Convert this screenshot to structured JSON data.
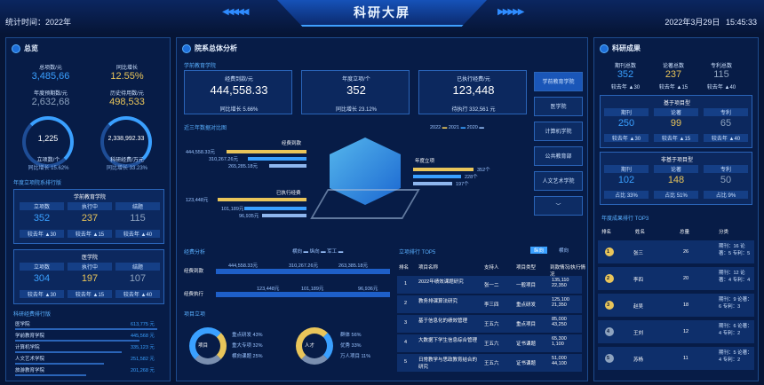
{
  "header": {
    "title": "科研大屏",
    "stat_time": "统计时间：2022年",
    "date": "2022年3月29日",
    "time": "15:45:33"
  },
  "overview": {
    "title": "总览",
    "k1_label": "总项数/元",
    "k1_value": "3,485,66",
    "k2_label": "同比增长",
    "k2_value": "12.55%",
    "k3_label": "年度预期数/元",
    "k3_value": "2,632,68",
    "k4_label": "历史待用数/元",
    "k4_value": "498,533",
    "g1_value": "1,225",
    "g1_label": "立项数/个",
    "g1_sub": "同比增长 15.62%",
    "g2_value": "2,338,992.33",
    "g2_label": "科研经费/万元",
    "g2_sub": "同比增长 33.23%",
    "college_title": "年度立项院系排行版",
    "college1": {
      "name": "学前教育学院",
      "h": [
        "立项数",
        "执行中",
        "结题"
      ],
      "v": [
        "352",
        "237",
        "115"
      ],
      "c": [
        "较去年 ▲30",
        "较去年 ▲15",
        "较去年 ▲40"
      ]
    },
    "college2": {
      "name": "医学院",
      "h": [
        "立项数",
        "执行中",
        "结题"
      ],
      "v": [
        "304",
        "197",
        "107"
      ],
      "c": [
        "较去年 ▲30",
        "较去年 ▲15",
        "较去年 ▲40"
      ]
    },
    "rank_title": "科研经费排行版",
    "rank": [
      {
        "n": "医学院",
        "v": "613,775 元"
      },
      {
        "n": "学前教育学院",
        "v": "445,568 元"
      },
      {
        "n": "计算机学院",
        "v": "335,123 元"
      },
      {
        "n": "人文艺术学院",
        "v": "251,582 元"
      },
      {
        "n": "旅游教育学院",
        "v": "201,268 元"
      }
    ]
  },
  "center": {
    "title": "院系总体分析",
    "sub": "学前教育学院",
    "cards": [
      {
        "label": "经费到款/元",
        "value": "444,558.33",
        "foot": "同比增长 5.66%"
      },
      {
        "label": "年度立项/个",
        "value": "352",
        "foot": "同比增长 23.12%"
      },
      {
        "label": "已执行经费/元",
        "value": "123,448",
        "foot": "待执行 332,561 元"
      }
    ],
    "side": [
      "学前教育学院",
      "医学院",
      "计算机学院",
      "公共教育部",
      "人文艺术学院"
    ],
    "side_more": "﹀",
    "compare_title": "近三年数据对比图",
    "legend": [
      "2022",
      "2021",
      "2020"
    ],
    "tags": {
      "a": "经费到款",
      "b": "已执行经费",
      "c": "年度立项"
    },
    "left_vals": [
      "444,558.33元",
      "310,267.26元",
      "265,285.18元",
      "123,448元",
      "101,189元",
      "96,935元"
    ],
    "right_vals": [
      "352个",
      "228个",
      "197个"
    ],
    "expense_title": "经费分析",
    "exp_legend": [
      "横向",
      "纵向",
      "军工"
    ],
    "exp_r1": [
      "经费到款",
      "444,558.33元",
      "310,267.26元",
      "263,385.18元"
    ],
    "exp_r2": [
      "经费执行",
      "123,448元",
      "101,189元",
      "96,936元"
    ],
    "proj_title": "项目立项",
    "donut1": "项目",
    "donut2": "人才",
    "d1": [
      "重点研发 43%",
      "重大专项 32%",
      "横向课题 25%"
    ],
    "d2": [
      "群体 56%",
      "优秀 33%",
      "万人项目 11%"
    ]
  },
  "top5": {
    "title": "立项排行 TOP5",
    "toggle": [
      "纵向",
      "横向"
    ],
    "h": [
      "排名",
      "项目名称",
      "支持人",
      "项目类型",
      "到款情况/执行情况"
    ],
    "rows": [
      {
        "r": "1",
        "n": "2022年绩效课题研究",
        "p": "张一二",
        "t": "一般项目",
        "v": "135,110 22,350"
      },
      {
        "r": "2",
        "n": "教务排课算法研究",
        "p": "李三四",
        "t": "重点研发",
        "v": "125,100 21,350"
      },
      {
        "r": "3",
        "n": "基于信息化的绩效管理",
        "p": "王五六",
        "t": "重点项目",
        "v": "85,000 43,250"
      },
      {
        "r": "4",
        "n": "大数据下学生信息综合管理",
        "p": "王五六",
        "t": "证书课题",
        "v": "65,300 1,100"
      },
      {
        "r": "5",
        "n": "日常教学与思政教育结合的研究",
        "p": "王五六",
        "t": "证书课题",
        "v": "51,000 44,100"
      }
    ]
  },
  "right": {
    "title": "科研成果",
    "top_h": [
      "期刊总数",
      "论著总数",
      "专利总数"
    ],
    "top_v": [
      "352",
      "237",
      "115"
    ],
    "top_c": [
      "较去年 ▲30",
      "较去年 ▲15",
      "较去年 ▲40"
    ],
    "g1": {
      "title": "基于项目型",
      "h": [
        "期刊",
        "论著",
        "专利"
      ],
      "v": [
        "250",
        "99",
        "65"
      ],
      "c": [
        "较去年 ▲30",
        "较去年 ▲15",
        "较去年 ▲40"
      ]
    },
    "g2": {
      "title": "非基于项目型",
      "h": [
        "期刊",
        "论著",
        "专利"
      ],
      "v": [
        "102",
        "148",
        "50"
      ],
      "c": [
        "占比 33%",
        "占比 51%",
        "占比 9%"
      ]
    },
    "rank_title": "年度成果排行 TOP3",
    "rh": [
      "排名",
      "姓名",
      "总量",
      "分类"
    ],
    "rows": [
      {
        "n": "张三",
        "t": "26",
        "d": "期刊：16 论著：5 专利：5"
      },
      {
        "n": "李四",
        "t": "20",
        "d": "期刊：12 论著：4 专利：4"
      },
      {
        "n": "赵吴",
        "t": "18",
        "d": "期刊：9 论著：6 专利：3"
      },
      {
        "n": "王刘",
        "t": "12",
        "d": "期刊：6 论著：4 专利：2"
      },
      {
        "n": "苏杨",
        "t": "11",
        "d": "期刊：5 论著：4 专利：2"
      }
    ],
    "ranks": [
      "1",
      "2",
      "3",
      "4",
      "5"
    ]
  }
}
